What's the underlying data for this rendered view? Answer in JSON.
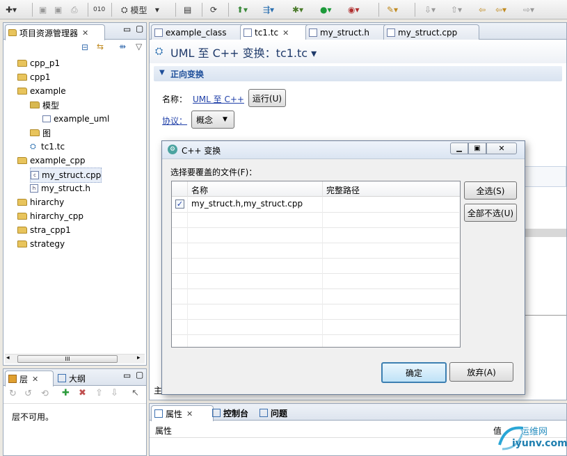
{
  "toolbar": {
    "model_label": "模型"
  },
  "explorer": {
    "title": "项目资源管理器",
    "items": [
      {
        "label": "cpp_p1",
        "indent": 0,
        "icon": "project-folder-icon"
      },
      {
        "label": "cpp1",
        "indent": 0,
        "icon": "project-folder-icon"
      },
      {
        "label": "example",
        "indent": 0,
        "icon": "project-folder-icon"
      },
      {
        "label": "模型",
        "indent": 1,
        "icon": "model-folder-icon"
      },
      {
        "label": "example_uml",
        "indent": 2,
        "icon": "folder-icon"
      },
      {
        "label": "图",
        "indent": 1,
        "icon": "diagram-folder-icon"
      },
      {
        "label": "tc1.tc",
        "indent": 1,
        "icon": "transform-config-icon"
      },
      {
        "label": "example_cpp",
        "indent": 0,
        "icon": "project-folder-icon"
      },
      {
        "label": "my_struct.cpp",
        "indent": 1,
        "icon": "cpp-file-icon",
        "selected": true
      },
      {
        "label": "my_struct.h",
        "indent": 1,
        "icon": "h-file-icon"
      },
      {
        "label": "hirarchy",
        "indent": 0,
        "icon": "project-folder-icon"
      },
      {
        "label": "hirarchy_cpp",
        "indent": 0,
        "icon": "project-folder-icon"
      },
      {
        "label": "stra_cpp1",
        "indent": 0,
        "icon": "project-folder-icon"
      },
      {
        "label": "strategy",
        "indent": 0,
        "icon": "project-folder-icon"
      }
    ],
    "scroll_thumb_label": "III"
  },
  "layers": {
    "tab_layers": "层",
    "tab_outline": "大纲",
    "message": "层不可用。"
  },
  "editor": {
    "tabs": [
      {
        "label": "example_class",
        "active": false
      },
      {
        "label": "tc1.tc",
        "active": true
      },
      {
        "label": "my_struct.h",
        "active": false
      },
      {
        "label": "my_struct.cpp",
        "active": false
      }
    ],
    "title": "UML 至 C++ 变换：tc1.tc",
    "section": "正向变换",
    "name_label": "名称：",
    "name_link": "UML 至 C++",
    "run_button": "运行(U)",
    "protocol_label": "协议：",
    "protocol_value": "概念",
    "footer_char": "主"
  },
  "dialog": {
    "title": "C++ 变换",
    "prompt": "选择要覆盖的文件(F)：",
    "columns": [
      "名称",
      "完整路径"
    ],
    "rows": [
      {
        "checked": true,
        "name": "my_struct.h,my_struct.cpp",
        "path": ""
      }
    ],
    "select_all": "全选(S)",
    "deselect_all": "全部不选(U)",
    "ok": "确定",
    "cancel": "放弃(A)"
  },
  "bottom": {
    "tabs": [
      {
        "label": "属性",
        "active": true
      },
      {
        "label": "控制台",
        "active": false
      },
      {
        "label": "问题",
        "active": false
      }
    ],
    "column_property": "属性",
    "column_value": "值"
  },
  "watermark": {
    "brand": "运维网",
    "url": "iyunv.com"
  }
}
